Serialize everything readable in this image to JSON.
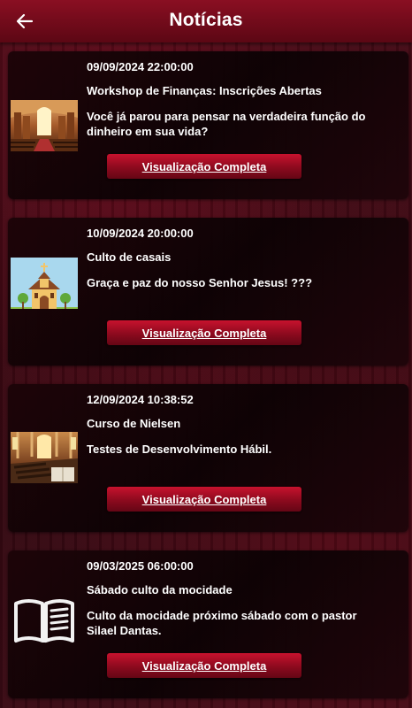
{
  "header": {
    "title": "Notícias"
  },
  "news": [
    {
      "date": "09/09/2024 22:00:00",
      "title": "Workshop de Finanças: Inscrições Abertas",
      "description": "Você já parou para pensar na verdadeira função do dinheiro em sua vida?",
      "button": "Visualização Completa",
      "thumbnail": "church-interior-photo"
    },
    {
      "date": "10/09/2024 20:00:00",
      "title": "Culto de casais",
      "description": "Graça e paz do nosso Senhor Jesus! ???",
      "button": "Visualização Completa",
      "thumbnail": "church-illustration"
    },
    {
      "date": "12/09/2024 10:38:52",
      "title": "Curso de Nielsen",
      "description": "Testes de Desenvolvimento Hábil.",
      "button": "Visualização Completa",
      "thumbnail": "church-interior-photo"
    },
    {
      "date": "09/03/2025 06:00:00",
      "title": "Sábado culto da mocidade",
      "description": "Culto da mocidade próximo sábado com o pastor Silael Dantas.",
      "button": "Visualização Completa",
      "thumbnail": "book-icon"
    }
  ]
}
